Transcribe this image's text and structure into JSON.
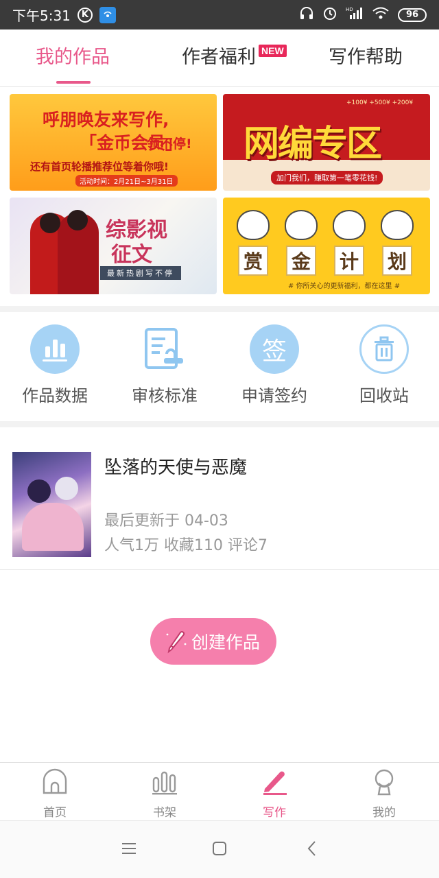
{
  "status_bar": {
    "time": "下午5:31",
    "k_icon": "K",
    "battery": "96",
    "hd": "HD"
  },
  "tabs": [
    {
      "label": "我的作品",
      "active": true
    },
    {
      "label": "作者福利",
      "badge": "NEW"
    },
    {
      "label": "写作帮助"
    }
  ],
  "banners": {
    "b1": {
      "line1": "呼朋唤友来写作,",
      "line2": "「金币会员」",
      "line2b": "领不停!",
      "line3": "还有首页轮播推荐位等着你哦!",
      "line4": "活动时间：2月21日~3月31日"
    },
    "b2": {
      "title": "网编专区",
      "coins": "+100¥  +500¥  +200¥",
      "sub": "加门我们，赚取第一笔零花钱!"
    },
    "b3": {
      "title1": "综影视",
      "title2": "征文",
      "sub": "最新热剧写不停"
    },
    "b4": {
      "chars": [
        "赏",
        "金",
        "计",
        "划"
      ],
      "sub": "# 你所关心的更新福利，都在这里 #"
    }
  },
  "shortcuts": [
    {
      "label": "作品数据",
      "icon": "bar-chart-icon"
    },
    {
      "label": "审核标准",
      "icon": "document-check-icon"
    },
    {
      "label": "申请签约",
      "icon": "sign-contract-icon",
      "glyph": "签"
    },
    {
      "label": "回收站",
      "icon": "trash-icon"
    }
  ],
  "work": {
    "title": "坠落的天使与恶魔",
    "updated": "最后更新于 04-03",
    "stats": "人气1万 收藏110 评论7"
  },
  "create_button": {
    "label": "创建作品"
  },
  "bottom_nav": [
    {
      "label": "首页",
      "icon": "home-icon"
    },
    {
      "label": "书架",
      "icon": "bookshelf-icon"
    },
    {
      "label": "写作",
      "icon": "pencil-icon",
      "active": true
    },
    {
      "label": "我的",
      "icon": "profile-icon"
    }
  ],
  "colors": {
    "accent": "#e8588a",
    "create_button": "#f57fac",
    "icon_blue": "#a6d3f5",
    "new_badge": "#e8285a"
  }
}
